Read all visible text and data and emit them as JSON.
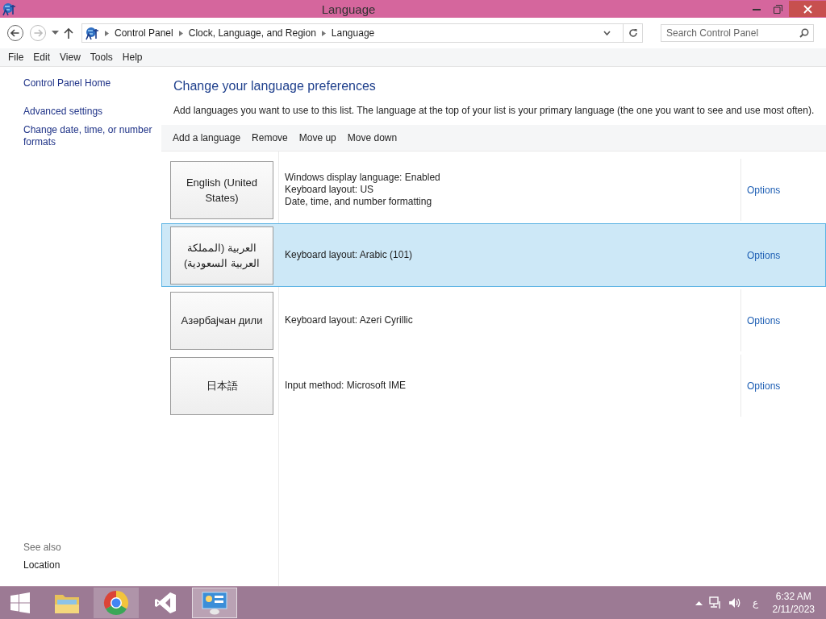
{
  "window": {
    "title": "Language"
  },
  "address_bar": {
    "breadcrumb": [
      "Control Panel",
      "Clock, Language, and Region",
      "Language"
    ],
    "search": {
      "placeholder": "Search Control Panel"
    }
  },
  "menu": [
    "File",
    "Edit",
    "View",
    "Tools",
    "Help"
  ],
  "sidebar": {
    "links": [
      "Control Panel Home",
      "Advanced settings",
      "Change date, time, or number formats"
    ],
    "see_also": {
      "heading": "See also",
      "links": [
        "Location"
      ]
    }
  },
  "content": {
    "heading": "Change your language preferences",
    "description": "Add languages you want to use to this list. The language at the top of your list is your primary language (the one you want to see and use most often).",
    "toolbar": [
      "Add a language",
      "Remove",
      "Move up",
      "Move down"
    ],
    "languages": [
      {
        "name": "English (United States)",
        "details": [
          "Windows display language: Enabled",
          "Keyboard layout: US",
          "Date, time, and number formatting"
        ],
        "options": "Options",
        "selected": false
      },
      {
        "name": "العربية (المملكة العربية السعودية)",
        "details": [
          "Keyboard layout: Arabic (101)"
        ],
        "options": "Options",
        "selected": true
      },
      {
        "name": "Азәрбајҹан дили",
        "details": [
          "Keyboard layout: Azeri Cyrillic"
        ],
        "options": "Options",
        "selected": false
      },
      {
        "name": "日本語",
        "details": [
          "Input method: Microsoft IME"
        ],
        "options": "Options",
        "selected": false
      }
    ]
  },
  "taskbar": {
    "apps": [
      {
        "kind": "start",
        "running": false,
        "selected": false
      },
      {
        "kind": "folder",
        "running": false,
        "selected": false
      },
      {
        "kind": "browser",
        "running": true,
        "selected": false
      },
      {
        "kind": "studio",
        "running": false,
        "selected": false
      },
      {
        "kind": "panel",
        "running": true,
        "selected": true
      }
    ],
    "input_indicator": "ع",
    "time": "6:32 AM",
    "date": "2/11/2023"
  }
}
